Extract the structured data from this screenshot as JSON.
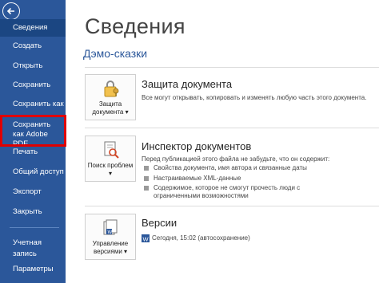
{
  "sidebar": {
    "items": [
      {
        "label": "Сведения",
        "selected": true
      },
      {
        "label": "Создать"
      },
      {
        "label": "Открыть"
      },
      {
        "label": "Сохранить"
      },
      {
        "label": "Сохранить как"
      },
      {
        "label": "Сохранить как Adobe PDF"
      },
      {
        "label": "Печать"
      },
      {
        "label": "Общий доступ"
      },
      {
        "label": "Экспорт"
      },
      {
        "label": "Закрыть"
      },
      {
        "label": "Учетная запись"
      },
      {
        "label": "Параметры"
      }
    ],
    "bg_color": "#2b579a",
    "highlight_color": "#e00000"
  },
  "main": {
    "title": "Сведения",
    "doc_name": "Дэмо-сказки",
    "sections": {
      "protect": {
        "button_label": "Защита документа",
        "button_has_dropdown": true,
        "title": "Защита документа",
        "text": "Все могут открывать, копировать и изменять любую часть этого документа."
      },
      "inspect": {
        "button_label": "Поиск проблем",
        "button_has_dropdown": true,
        "title": "Инспектор документов",
        "intro": "Перед публикацией этого файла не забудьте, что он содержит:",
        "bullets": [
          "Свойства документа, имя автора и связанные даты",
          "Настраиваемые XML-данные",
          "Содержимое, которое не смогут прочесть люди с ограниченными возможностями"
        ]
      },
      "versions": {
        "button_label": "Управление версиями",
        "button_has_dropdown": true,
        "title": "Версии",
        "entry": "Сегодня, 15:02 (автосохранение)"
      }
    },
    "accent_color": "#2b579a"
  }
}
